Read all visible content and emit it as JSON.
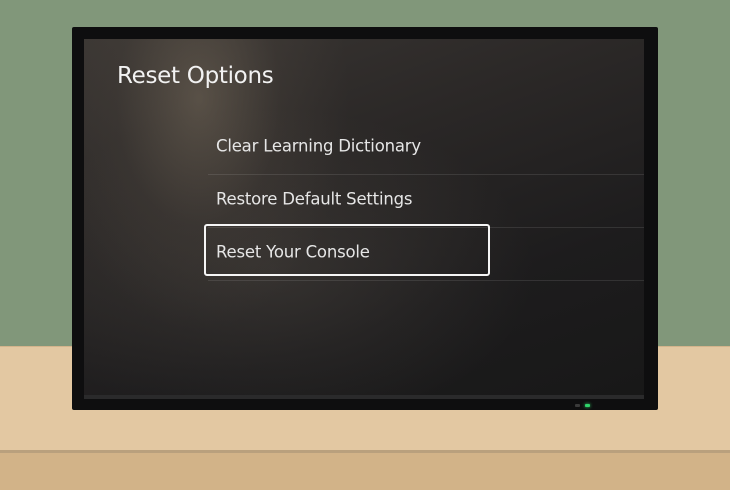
{
  "screen": {
    "title": "Reset Options",
    "menu_items": [
      {
        "label": "Clear Learning Dictionary",
        "focused": false
      },
      {
        "label": "Restore Default Settings",
        "focused": false
      },
      {
        "label": "Reset Your Console",
        "focused": true
      }
    ]
  },
  "colors": {
    "wall": "#81977a",
    "desk": "#e3c8a2",
    "tv_bezel": "#0e0e0f",
    "focus_ring": "#f5f5f5",
    "power_led": "#2fd46a"
  },
  "icons": [
    "power-led-indicator"
  ]
}
